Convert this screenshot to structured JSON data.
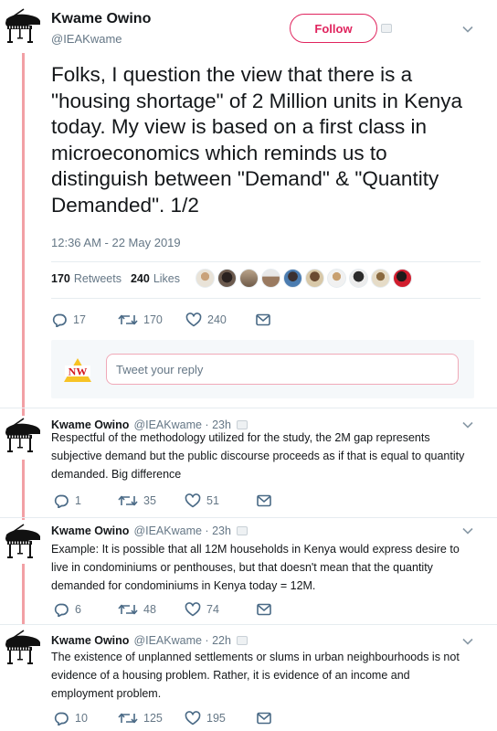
{
  "main_tweet": {
    "author_name": "Kwame Owino",
    "handle": "@IEAKwame",
    "follow_label": "Follow",
    "text": "Folks, I question the view that there is a \"housing shortage\" of 2 Million units in Kenya today. My view is based on a first class in microeconomics which reminds us to distinguish between \"Demand\" & \"Quantity Demanded\". 1/2",
    "timestamp": "12:36 AM - 22 May 2019",
    "retweets_count": "170",
    "retweets_label": "Retweets",
    "likes_count": "240",
    "likes_label": "Likes",
    "reply_count": "17",
    "retweet_action_count": "170",
    "like_action_count": "240"
  },
  "reply_box": {
    "placeholder": "Tweet your reply"
  },
  "replies": [
    {
      "author_name": "Kwame Owino",
      "handle_time": "@IEAKwame · 23h",
      "text": "Respectful of the methodology utilized for the study, the 2M gap represents subjective demand but the public discourse proceeds as if that is equal to quantity demanded. Big difference",
      "reply_count": "1",
      "retweet_count": "35",
      "like_count": "51"
    },
    {
      "author_name": "Kwame Owino",
      "handle_time": "@IEAKwame · 23h",
      "text": "Example: It is possible that all 12M households in Kenya would express desire to live in condominiums or penthouses, but that doesn't mean that the quantity demanded for condominiums in Kenya today = 12M.",
      "reply_count": "6",
      "retweet_count": "48",
      "like_count": "74"
    },
    {
      "author_name": "Kwame Owino",
      "handle_time": "@IEAKwame · 22h",
      "text": "The existence of unplanned settlements or slums in urban neighbourhoods is not evidence of a housing problem. Rather, it is evidence of an income and employment problem.",
      "reply_count": "10",
      "retweet_count": "125",
      "like_count": "195"
    }
  ],
  "colors": {
    "follow_accent": "#e0245e",
    "thread_line": "#f2a0a5",
    "secondary_text": "#657786"
  },
  "icons": [
    "piano-avatar-icon",
    "verified-badge-icon",
    "chevron-down-icon",
    "reply-icon",
    "retweet-icon",
    "like-icon",
    "message-icon"
  ]
}
